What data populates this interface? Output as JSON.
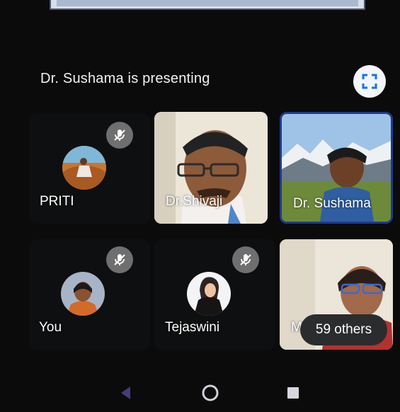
{
  "presentation": {
    "status_text": "Dr. Sushama is presenting"
  },
  "participants": [
    {
      "name": "PRITI",
      "muted": true
    },
    {
      "name": "Dr.Shivaji",
      "muted": false
    },
    {
      "name": "Dr. Sushama",
      "muted": false,
      "presenting": true
    },
    {
      "name": "You",
      "muted": true
    },
    {
      "name": "Tejaswini",
      "muted": true
    },
    {
      "name": "M",
      "muted": false
    }
  ],
  "others": {
    "label": "59 others"
  },
  "icons": {
    "fullscreen": "fullscreen-icon",
    "mic_off": "mic-off-icon",
    "nav_back": "back-triangle-icon",
    "nav_home": "home-circle-icon",
    "nav_recents": "recents-square-icon"
  },
  "colors": {
    "background": "#0b0b0c",
    "presenter_border": "#1f3a8a",
    "mute_badge": "#6f6f6f",
    "fullscreen_icon": "#1a73e8"
  }
}
